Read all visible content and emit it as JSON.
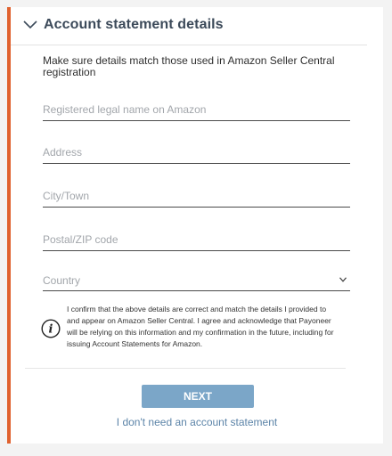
{
  "section": {
    "title": "Account statement details",
    "intro": "Make sure details match those used in Amazon Seller Central registration"
  },
  "fields": {
    "legal_name_placeholder": "Registered legal name on Amazon",
    "address_placeholder": "Address",
    "city_placeholder": "City/Town",
    "postal_placeholder": "Postal/ZIP code",
    "country_placeholder": "Country"
  },
  "notice": {
    "text": "I confirm that the above details are correct and match the details I provided to and appear on Amazon Seller Central. I agree and acknowledge that Payoneer will be relying on this information and my confirmation in the future, including for issuing Account Statements for Amazon."
  },
  "actions": {
    "next_label": "NEXT",
    "skip_label": "I don't need an account statement"
  },
  "colors": {
    "accent_border": "#e0622f",
    "button_bg": "#7ba6c8",
    "link": "#5c84a8"
  },
  "icons": {
    "collapse": "chevron-down-icon",
    "country_caret": "chevron-down-icon",
    "notice": "info-icon"
  }
}
